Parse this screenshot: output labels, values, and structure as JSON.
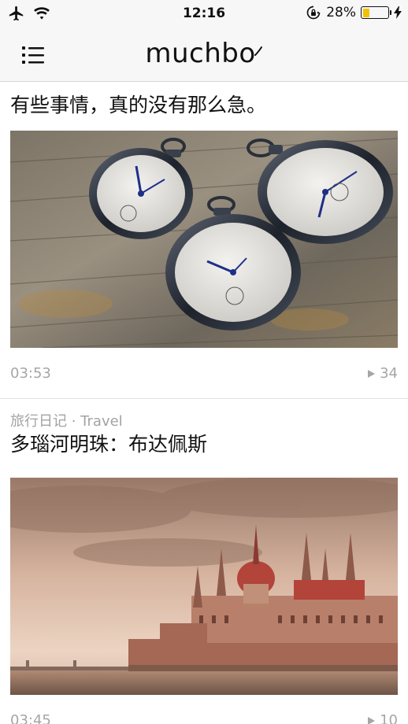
{
  "status_bar": {
    "time": "12:16",
    "battery_percent_text": "28%",
    "battery_level": 0.28,
    "icons": [
      "airplane-icon",
      "wifi-icon",
      "orientation-lock-icon",
      "battery-icon",
      "charging-bolt-icon"
    ]
  },
  "nav": {
    "menu_icon": "menu-list-icon",
    "logo_text": "muchbo"
  },
  "feed": [
    {
      "category": "",
      "title": "有些事情，真的没有那么急。",
      "duration": "03:53",
      "views": "34"
    },
    {
      "category": "旅行日记 · Travel",
      "title": "多瑙河明珠：布达佩斯",
      "duration": "03:45",
      "views": "10"
    }
  ],
  "colors": {
    "bar_background": "#f7f7f7",
    "meta_text": "#a6a6a6",
    "battery_fill": "#f2c200"
  }
}
